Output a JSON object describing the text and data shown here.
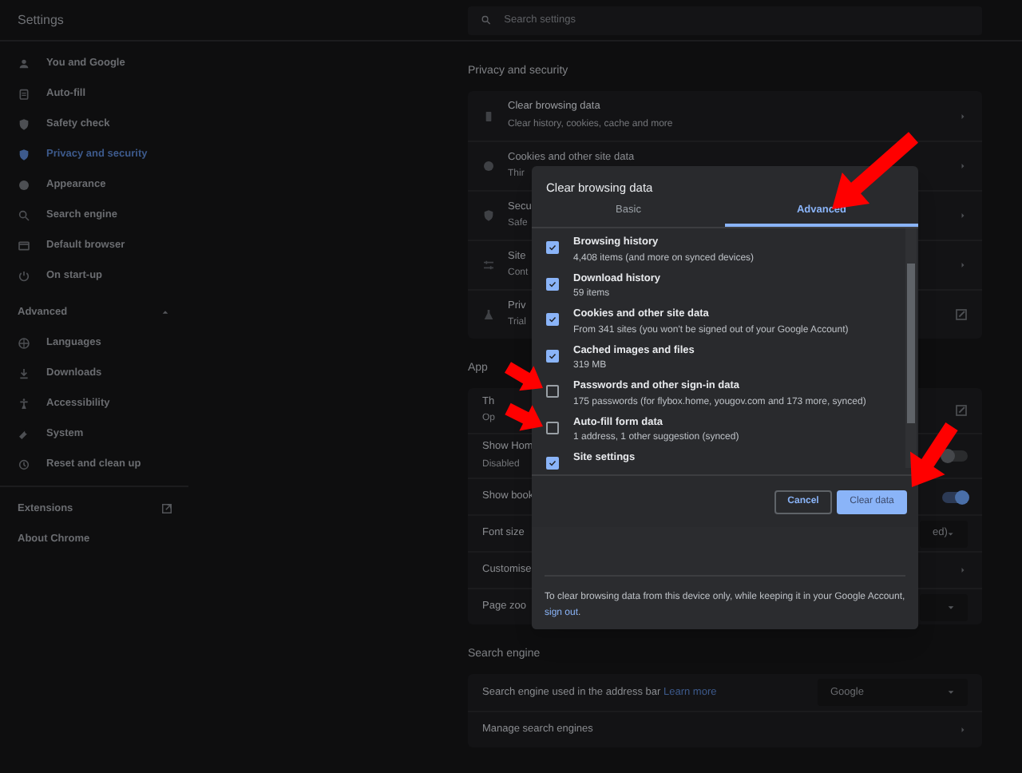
{
  "header": {
    "title": "Settings",
    "search": {
      "placeholder": "Search settings"
    }
  },
  "sidebar": {
    "items": [
      {
        "label": "You and Google",
        "selected": false
      },
      {
        "label": "Auto-fill",
        "selected": false
      },
      {
        "label": "Safety check",
        "selected": false
      },
      {
        "label": "Privacy and security",
        "selected": true
      },
      {
        "label": "Appearance",
        "selected": false
      },
      {
        "label": "Search engine",
        "selected": false
      },
      {
        "label": "Default browser",
        "selected": false
      },
      {
        "label": "On start-up",
        "selected": false
      }
    ],
    "advanced": {
      "label": "Advanced",
      "expanded": true,
      "items": [
        {
          "label": "Languages",
          "selected": false
        },
        {
          "label": "Downloads",
          "selected": false
        },
        {
          "label": "Accessibility",
          "selected": false
        },
        {
          "label": "System",
          "selected": false
        },
        {
          "label": "Reset and clean up",
          "selected": false
        }
      ]
    },
    "links": [
      {
        "label": "Extensions",
        "external": true
      },
      {
        "label": "About Chrome",
        "external": false
      }
    ]
  },
  "sections": [
    {
      "title": "Privacy and security",
      "rows": [
        {
          "kind": "nav",
          "title": "Clear browsing data",
          "subtitle": "Clear history, cookies, cache and more"
        },
        {
          "kind": "nav",
          "title": "Cookies and other site data",
          "subtitle": "Thir"
        },
        {
          "kind": "nav",
          "title": "Secu",
          "subtitle": "Safe"
        },
        {
          "kind": "nav",
          "title": "Site",
          "subtitle": "Cont"
        },
        {
          "kind": "external",
          "title": "Priv",
          "subtitle": "Trial"
        }
      ]
    },
    {
      "title": "App",
      "rows": [
        {
          "kind": "external",
          "title": "Th",
          "subtitle": "Op"
        },
        {
          "kind": "toggle",
          "title": "Show Hom",
          "subtitle": "Disabled",
          "on": false
        },
        {
          "kind": "toggle",
          "title": "Show book",
          "on": true
        },
        {
          "kind": "select",
          "title": "Font size",
          "value": "ed)"
        },
        {
          "kind": "nav",
          "title": "Customise"
        },
        {
          "kind": "select",
          "title": "Page zoo"
        }
      ]
    },
    {
      "title": "Search engine",
      "rows": [
        {
          "kind": "select",
          "title": "Search engine used in the address bar",
          "link": "Learn more",
          "value": "Google"
        },
        {
          "kind": "nav",
          "title": "Manage search engines"
        }
      ]
    }
  ],
  "dialog": {
    "title": "Clear browsing data",
    "tabs": [
      {
        "label": "Basic",
        "selected": false
      },
      {
        "label": "Advanced",
        "selected": true
      }
    ],
    "items": [
      {
        "title": "Browsing history",
        "subtitle": "4,408 items (and more on synced devices)",
        "checked": true
      },
      {
        "title": "Download history",
        "subtitle": "59 items",
        "checked": true
      },
      {
        "title": "Cookies and other site data",
        "subtitle": "From 341 sites (you won't be signed out of your Google Account)",
        "checked": true
      },
      {
        "title": "Cached images and files",
        "subtitle": "319 MB",
        "checked": true
      },
      {
        "title": "Passwords and other sign-in data",
        "subtitle": "175 passwords (for flybox.home, yougov.com and 173 more, synced)",
        "checked": false
      },
      {
        "title": "Auto-fill form data",
        "subtitle": "1 address, 1 other suggestion (synced)",
        "checked": false
      },
      {
        "title": "Site settings",
        "checked": true
      }
    ],
    "buttons": [
      {
        "label": "Cancel",
        "kind": "secondary"
      },
      {
        "label": "Clear data",
        "kind": "primary"
      }
    ],
    "note": {
      "text": "To clear browsing data from this device only, while keeping it in your Google Account,",
      "link": "sign out",
      "end": "."
    }
  }
}
